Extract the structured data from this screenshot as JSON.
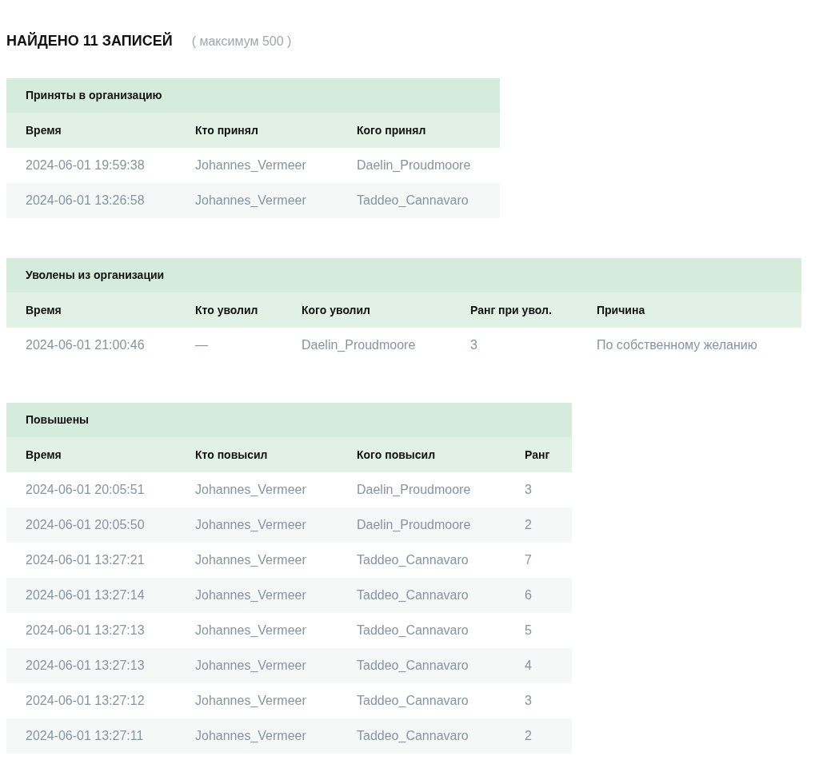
{
  "heading": {
    "title": "НАЙДЕНО 11 ЗАПИСЕЙ",
    "note": "( максимум 500 )"
  },
  "tables": [
    {
      "title": "Приняты в организацию",
      "columns": [
        "Время",
        "Кто принял",
        "Кого принял"
      ],
      "rows": [
        [
          "2024-06-01 19:59:38",
          "Johannes_Vermeer",
          "Daelin_Proudmoore"
        ],
        [
          "2024-06-01 13:26:58",
          "Johannes_Vermeer",
          "Taddeo_Cannavaro"
        ]
      ]
    },
    {
      "title": "Уволены из организации",
      "columns": [
        "Время",
        "Кто уволил",
        "Кого уволил",
        "Ранг при увол.",
        "Причина"
      ],
      "rows": [
        [
          "2024-06-01 21:00:46",
          "—",
          "Daelin_Proudmoore",
          "3",
          "По собственному желанию"
        ]
      ]
    },
    {
      "title": "Повышены",
      "columns": [
        "Время",
        "Кто повысил",
        "Кого повысил",
        "Ранг"
      ],
      "rows": [
        [
          "2024-06-01 20:05:51",
          "Johannes_Vermeer",
          "Daelin_Proudmoore",
          "3"
        ],
        [
          "2024-06-01 20:05:50",
          "Johannes_Vermeer",
          "Daelin_Proudmoore",
          "2"
        ],
        [
          "2024-06-01 13:27:21",
          "Johannes_Vermeer",
          "Taddeo_Cannavaro",
          "7"
        ],
        [
          "2024-06-01 13:27:14",
          "Johannes_Vermeer",
          "Taddeo_Cannavaro",
          "6"
        ],
        [
          "2024-06-01 13:27:13",
          "Johannes_Vermeer",
          "Taddeo_Cannavaro",
          "5"
        ],
        [
          "2024-06-01 13:27:13",
          "Johannes_Vermeer",
          "Taddeo_Cannavaro",
          "4"
        ],
        [
          "2024-06-01 13:27:12",
          "Johannes_Vermeer",
          "Taddeo_Cannavaro",
          "3"
        ],
        [
          "2024-06-01 13:27:11",
          "Johannes_Vermeer",
          "Taddeo_Cannavaro",
          "2"
        ]
      ]
    }
  ]
}
